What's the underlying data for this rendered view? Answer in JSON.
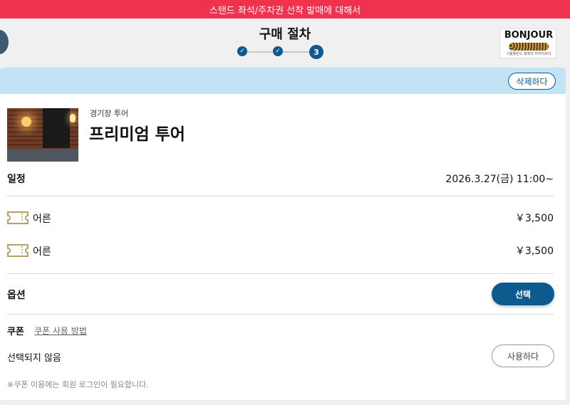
{
  "notice": {
    "text": "스탠드 좌석/주차권 선착 발매에 대해서"
  },
  "header": {
    "title": "구매 절차",
    "steps": {
      "step1": "✓",
      "step2": "✓",
      "step3": "3"
    }
  },
  "logo": {
    "text": "BONJOUR",
    "subtitle": "시돌플린드 로봇의 아카이브다"
  },
  "cart": {
    "delete_label": "삭제하다",
    "category": "경기장 투어",
    "name": "프리미엄 투어",
    "schedule_label": "일정",
    "schedule_value": "2026.3.27(금) 11:00~",
    "tickets": [
      {
        "label": "어른",
        "price": "￥3,500"
      },
      {
        "label": "어른",
        "price": "￥3,500"
      }
    ],
    "option_label": "옵션",
    "select_label": "선택",
    "coupon_label": "쿠폰",
    "coupon_link": "쿠폰 사용 방법",
    "coupon_status": "선택되지 않음",
    "use_label": "사용하다",
    "login_note": "※쿠폰 이용에는 회원 로그인이 필요합니다."
  },
  "colors": {
    "notice_bg": "#f0324f",
    "accent": "#0e5a8f",
    "card_bar": "#c3e4f5",
    "ticket_icon": "#b8a068"
  },
  "icons": [
    "check-icon",
    "ticket-icon"
  ]
}
